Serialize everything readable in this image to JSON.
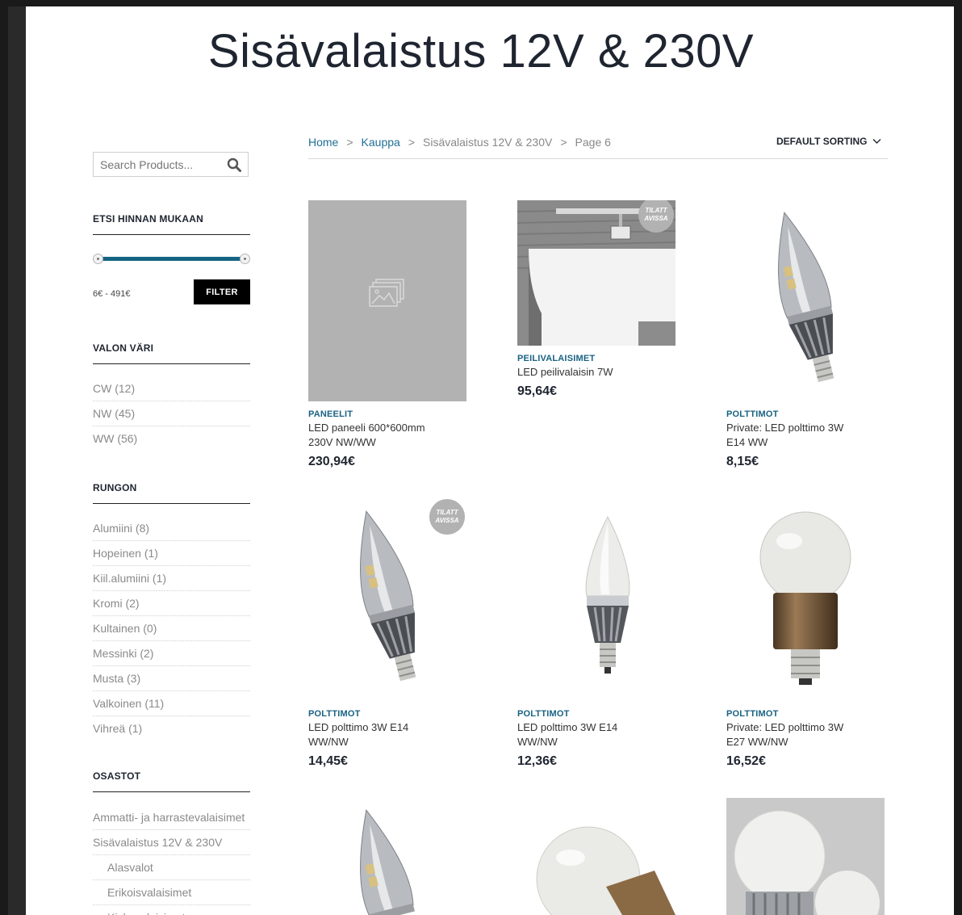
{
  "page": {
    "title": "Sisävalaistus 12V & 230V"
  },
  "search": {
    "placeholder": "Search Products...",
    "icon": "search-icon"
  },
  "price_filter": {
    "title": "ETSI HINNAN MUKAAN",
    "range_text": "6€ - 491€",
    "button_label": "FILTER",
    "slider_min_fraction": 0,
    "slider_max_fraction": 1
  },
  "color_filter": {
    "title": "VALON VÄRI",
    "items": [
      "CW (12)",
      "NW (45)",
      "WW (56)"
    ]
  },
  "body_filter": {
    "title": "RUNGON",
    "items": [
      "Alumiini (8)",
      "Hopeinen (1)",
      "Kiil.alumiini (1)",
      "Kromi (2)",
      "Kultainen (0)",
      "Messinki (2)",
      "Musta (3)",
      "Valkoinen (11)",
      "Vihreä (1)"
    ]
  },
  "departments": {
    "title": "OSASTOT",
    "items": [
      "Ammatti- ja harrastevalaisimet",
      "Sisävalaistus 12V & 230V"
    ],
    "subitems": [
      "Alasvalot",
      "Erikoisvalaisimet",
      "Kiskovalaisimet"
    ]
  },
  "breadcrumb": {
    "home": "Home",
    "shop": "Kauppa",
    "category": "Sisävalaistus 12V & 230V",
    "page": "Page 6",
    "separator": ">"
  },
  "sorting": {
    "label": "DEFAULT SORTING",
    "icon": "chevron-down-icon"
  },
  "badge_text": "TILATT AVISSA",
  "products": [
    {
      "category": "PANEELIT",
      "name": "LED paneeli 600*600mm 230V NW/WW",
      "price": "230,94€",
      "image": "placeholder-image-icon"
    },
    {
      "category": "PEILIVALAISIMET",
      "name": "LED peilivalaisin 7W",
      "price": "95,64€",
      "image": "mirror-light-photo",
      "badge": true
    },
    {
      "category": "POLTTIMOT",
      "name": "Private: LED polttimo 3W E14 WW",
      "price": "8,15€",
      "image": "candle-bulb-photo"
    },
    {
      "category": "POLTTIMOT",
      "name": "LED polttimo 3W E14 WW/NW",
      "price": "14,45€",
      "image": "candle-bulb-photo",
      "badge": true
    },
    {
      "category": "POLTTIMOT",
      "name": "LED polttimo 3W E14 WW/NW",
      "price": "12,36€",
      "image": "frosted-candle-bulb-photo"
    },
    {
      "category": "POLTTIMOT",
      "name": "Private: LED polttimo 3W E27 WW/NW",
      "price": "16,52€",
      "image": "globe-bulb-photo"
    },
    {
      "image": "candle-bulb-photo"
    },
    {
      "image": "globe-bulb-photo"
    },
    {
      "image": "globe-bulbs-photo"
    }
  ],
  "colors": {
    "accent": "#1a6283",
    "link": "#1f6f95",
    "slider": "#156582",
    "button": "#000000"
  }
}
